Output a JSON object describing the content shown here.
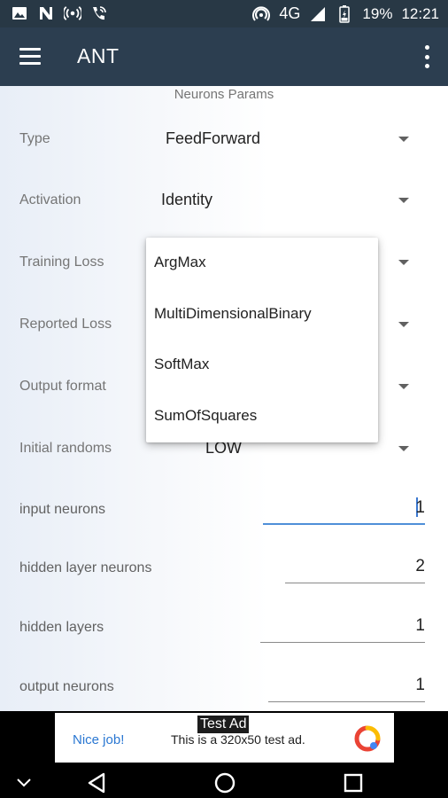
{
  "status_bar": {
    "network": "4G",
    "battery": "19%",
    "time": "12:21",
    "icons": [
      "image-icon",
      "n-icon",
      "broadcast-icon",
      "phone-icon",
      "hotspot-icon",
      "signal-icon",
      "battery-icon"
    ]
  },
  "app_bar": {
    "title": "ANT"
  },
  "section_title": "Neurons Params",
  "params": [
    {
      "label": "Type",
      "value": "FeedForward"
    },
    {
      "label": "Activation",
      "value": "Identity"
    },
    {
      "label": "Training Loss",
      "value": ""
    },
    {
      "label": "Reported Loss",
      "value": ""
    },
    {
      "label": "Output format",
      "value": ""
    },
    {
      "label": "Initial randoms",
      "value": "LOW"
    }
  ],
  "fields": [
    {
      "label": "input neurons",
      "value": "1"
    },
    {
      "label": "hidden layer neurons",
      "value": "2"
    },
    {
      "label": "hidden layers",
      "value": "1"
    },
    {
      "label": "output neurons",
      "value": "1"
    }
  ],
  "dropdown": {
    "options": [
      "ArgMax",
      "MultiDimensionalBinary",
      "SoftMax",
      "SumOfSquares"
    ]
  },
  "ad": {
    "label": "Test Ad",
    "cta": "Nice job!",
    "text": "This is a 320x50 test ad."
  },
  "colors": {
    "app_bar": "#2c3e50",
    "status_bar": "#283845",
    "accent": "#4f8fd8"
  }
}
